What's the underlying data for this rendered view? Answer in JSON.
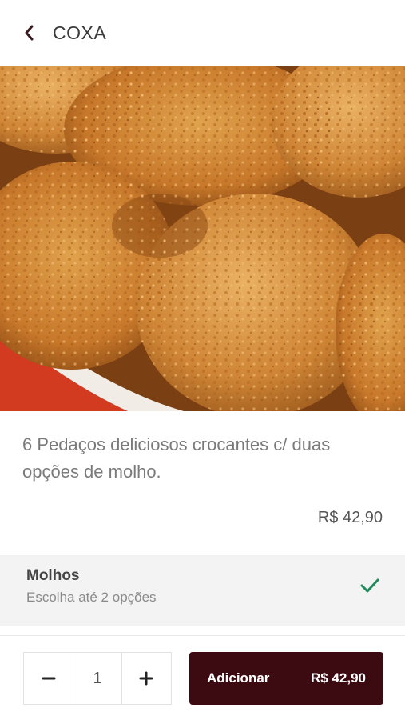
{
  "header": {
    "title": "COXA",
    "back_icon": "chevron-left-icon"
  },
  "product": {
    "image_subject": "fried chicken pieces",
    "description": "6 Pedaços deliciosos crocantes c/ duas opções de molho.",
    "price": "R$ 42,90"
  },
  "options": {
    "title": "Molhos",
    "subtitle": "Escolha até 2 opções",
    "status_icon": "check-icon",
    "status_color": "#1f8a5b"
  },
  "footer": {
    "quantity": "1",
    "decrement_icon": "minus-icon",
    "increment_icon": "plus-icon",
    "add_label": "Adicionar",
    "add_price": "R$ 42,90",
    "accent_color": "#3c0b11"
  }
}
